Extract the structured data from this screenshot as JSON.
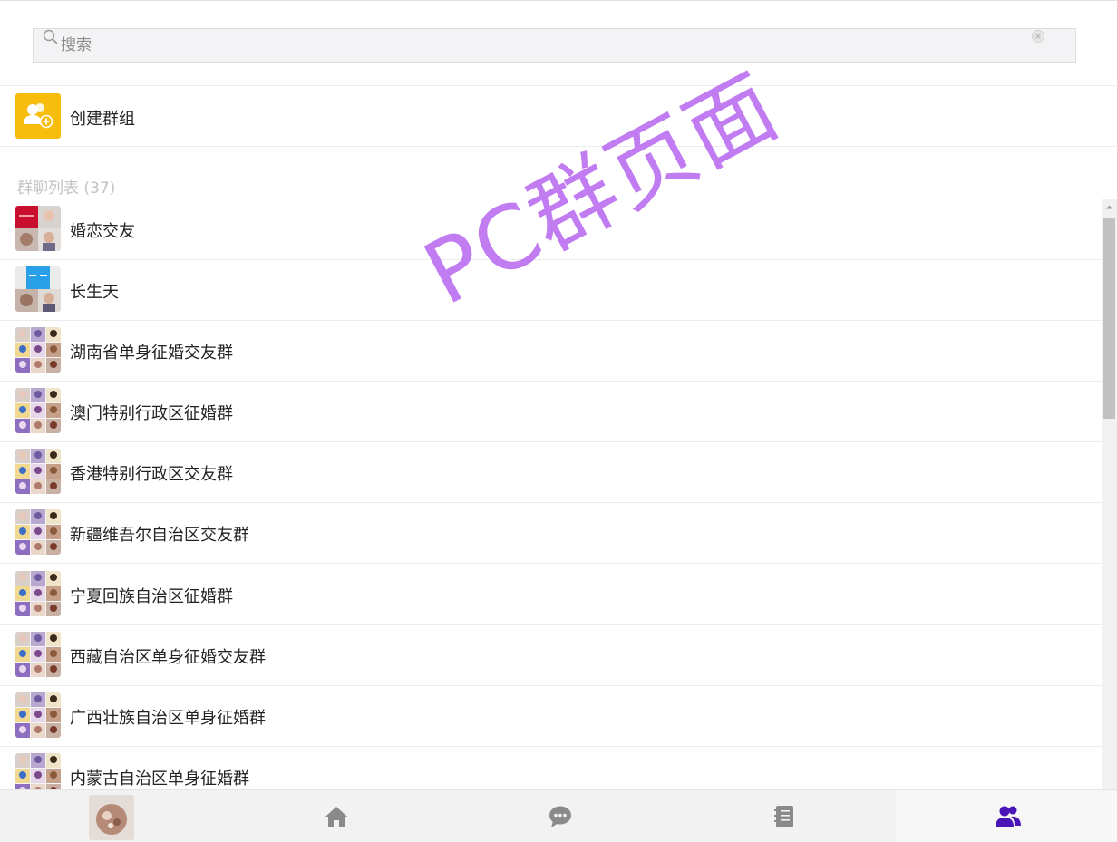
{
  "search": {
    "placeholder": "搜索"
  },
  "create_group": {
    "label": "创建群组"
  },
  "group_list": {
    "title": "群聊列表 (37)",
    "items": [
      {
        "name": "婚恋交友",
        "avatar": "mixed-photos-avatar"
      },
      {
        "name": "长生天",
        "avatar": "cartoon-avatar"
      },
      {
        "name": "湖南省单身征婚交友群",
        "avatar": "collage-avatar"
      },
      {
        "name": "澳门特别行政区征婚群",
        "avatar": "collage-avatar"
      },
      {
        "name": "香港特别行政区交友群",
        "avatar": "collage-avatar"
      },
      {
        "name": "新疆维吾尔自治区交友群",
        "avatar": "collage-avatar"
      },
      {
        "name": "宁夏回族自治区征婚群",
        "avatar": "collage-avatar"
      },
      {
        "name": "西藏自治区单身征婚交友群",
        "avatar": "collage-avatar"
      },
      {
        "name": "广西壮族自治区单身征婚群",
        "avatar": "collage-avatar"
      },
      {
        "name": "内蒙古自治区单身征婚群",
        "avatar": "collage-avatar"
      }
    ]
  },
  "watermark": {
    "text": "PC群页面"
  },
  "tabbar": {
    "tabs": [
      {
        "icon": "profile-avatar",
        "active": false
      },
      {
        "icon": "home-icon",
        "active": false
      },
      {
        "icon": "chat-icon",
        "active": false
      },
      {
        "icon": "contacts-book-icon",
        "active": false
      },
      {
        "icon": "group-icon",
        "active": true
      }
    ]
  },
  "colors": {
    "create_icon_bg": "#f8bc0c",
    "active_tab": "#4a16b8",
    "inactive_tab": "#8a8a8a",
    "watermark": "#c07cf0"
  }
}
